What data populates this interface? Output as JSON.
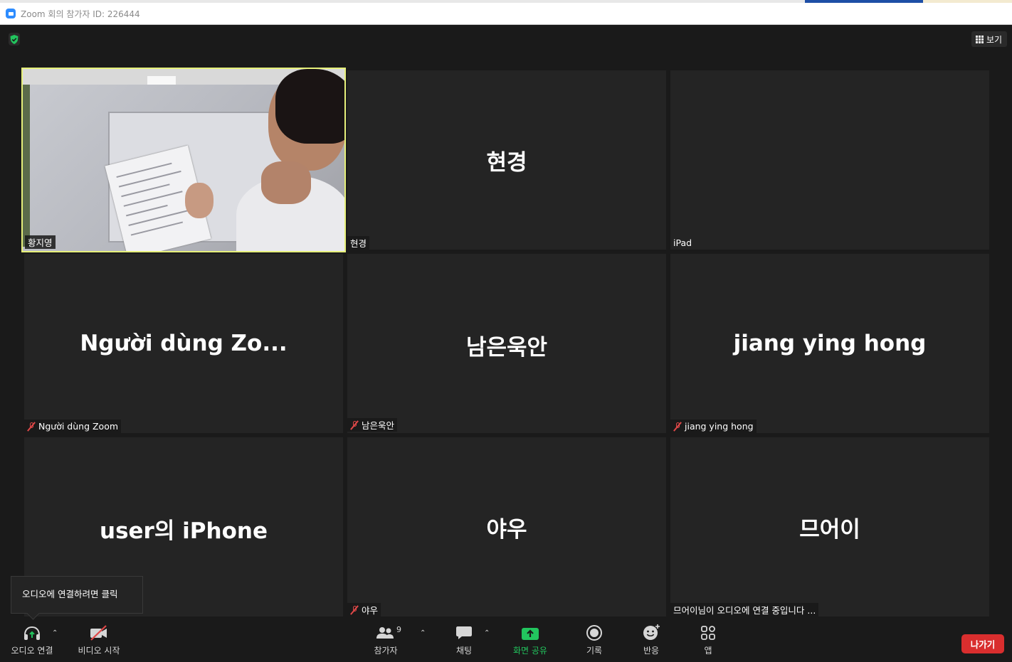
{
  "window": {
    "title": "Zoom 회의 참가자 ID: 226444"
  },
  "top_bar": {
    "view_label": "보기"
  },
  "tiles": [
    {
      "label": "황지영",
      "big_name": "",
      "muted": false,
      "video": true
    },
    {
      "label": "현경",
      "big_name": "현경",
      "muted": false
    },
    {
      "label": "iPad",
      "big_name": "",
      "muted": false
    },
    {
      "label": "Người dùng Zoom",
      "big_name": "Người dùng Zo...",
      "muted": true
    },
    {
      "label": "남은욱안",
      "big_name": "남은욱안",
      "muted": true
    },
    {
      "label": "jiang ying hong",
      "big_name": "jiang ying hong",
      "muted": true
    },
    {
      "label": "",
      "big_name": "user의 iPhone",
      "muted": false
    },
    {
      "label": "야우",
      "big_name": "야우",
      "muted": true
    },
    {
      "label": "므어이님이 오디오에 연결 중입니다 ...",
      "big_name": "므어이",
      "muted": false
    }
  ],
  "tooltip": {
    "text": "오디오에 연결하려면 클릭"
  },
  "toolbar": {
    "audio_label": "오디오 연결",
    "video_label": "비디오 시작",
    "participants_label": "참가자",
    "participants_count": "9",
    "chat_label": "채팅",
    "share_label": "화면 공유",
    "record_label": "기록",
    "reactions_label": "반응",
    "apps_label": "앱",
    "leave_label": "나가기"
  },
  "colors": {
    "share_green": "#22c55e",
    "leave_red": "#d92e2e",
    "active_speaker": "#e6f07a",
    "muted_red": "#e04848"
  }
}
